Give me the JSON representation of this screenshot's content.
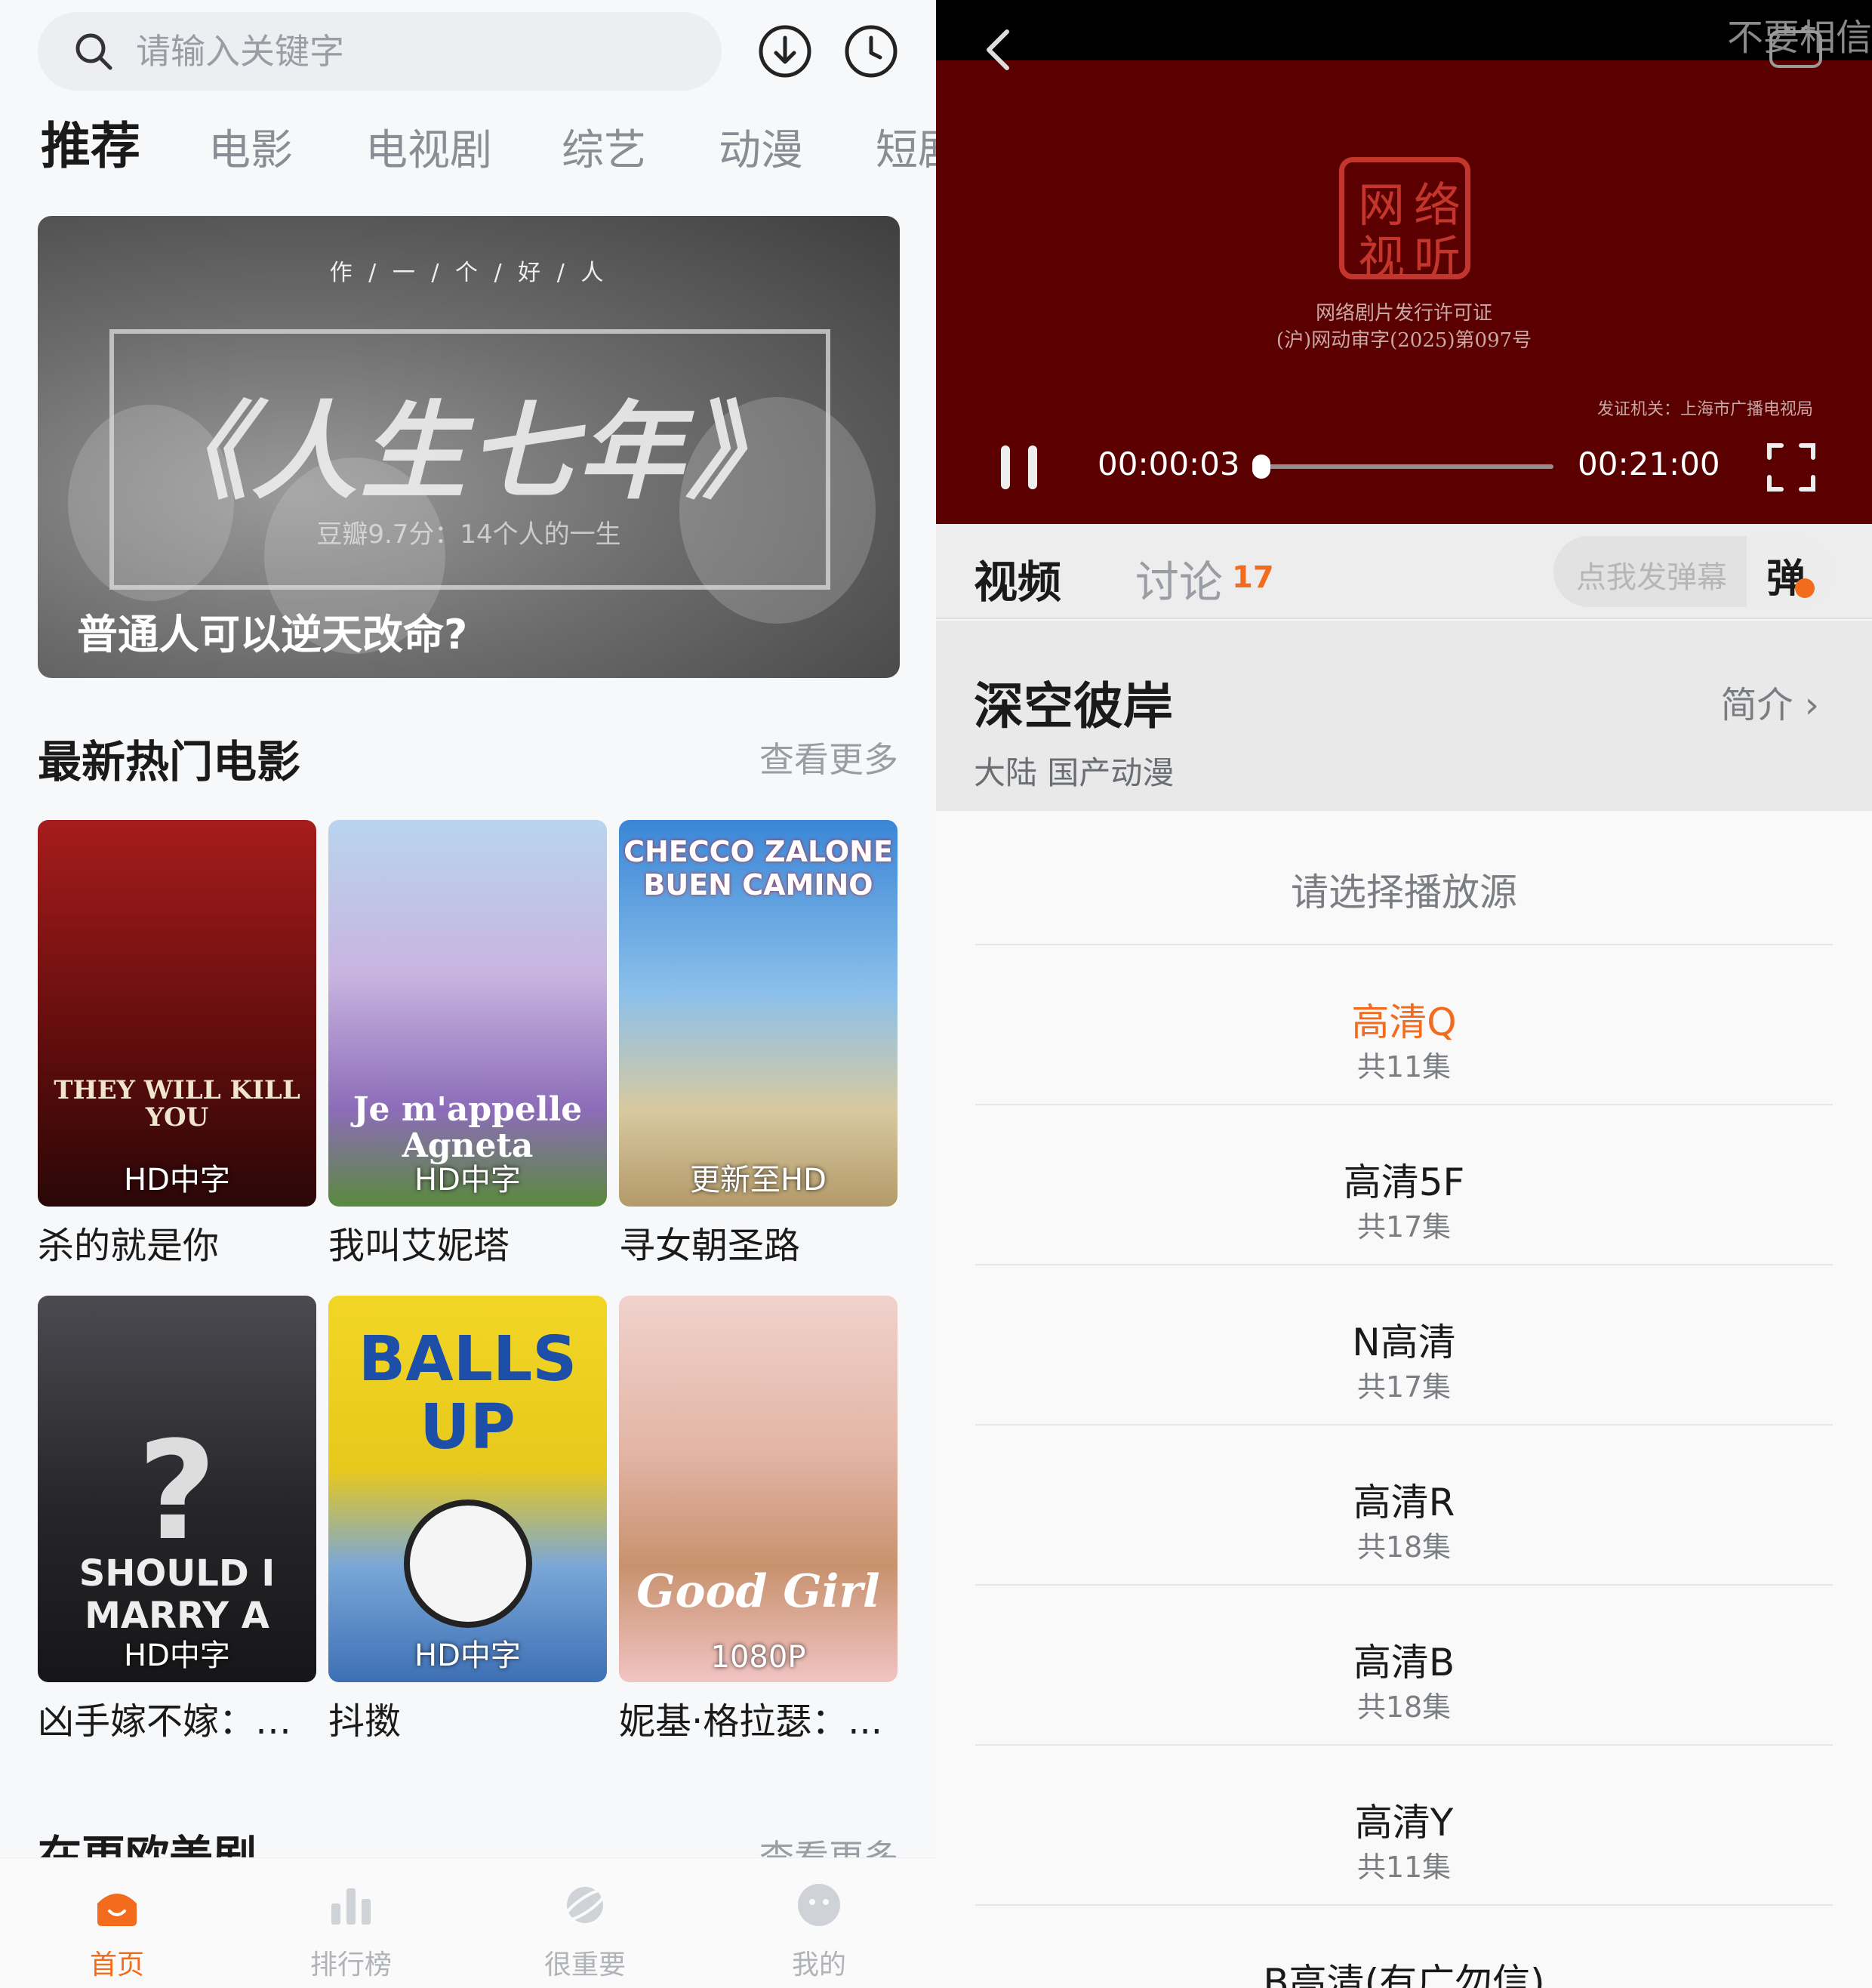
{
  "left": {
    "search": {
      "placeholder": "请输入关键字"
    },
    "tabs": [
      "推荐",
      "电影",
      "电视剧",
      "综艺",
      "动漫",
      "短剧"
    ],
    "banner": {
      "tagline": "作 / 一 / 个 / 好 / 人",
      "title": "《人生七年》",
      "subtitle": "豆瓣9.7分：14个人的一生",
      "caption": "普通人可以逆天改命?"
    },
    "section1": {
      "title": "最新热门电影",
      "more": "查看更多"
    },
    "movies": [
      {
        "name": "杀的就是你",
        "badge": "HD中字",
        "poster_text": "THEY WILL KILL YOU",
        "bg": "#8b1515"
      },
      {
        "name": "我叫艾妮塔",
        "badge": "HD中字",
        "poster_text": "Je m'appelle Agneta",
        "bg": "#a58fc8"
      },
      {
        "name": "寻女朝圣路",
        "badge": "更新至HD",
        "poster_text": "CHECCO ZALONE BUEN CAMINO",
        "bg": "#4f8fd0"
      },
      {
        "name": "凶手嫁不嫁：未...",
        "badge": "HD中字",
        "poster_text": "SHOULD I MARRY A",
        "bg": "#2a2a2e"
      },
      {
        "name": "抖擞",
        "badge": "HD中字",
        "poster_text": "BALLS UP",
        "bg": "#e8d020"
      },
      {
        "name": "妮基·格拉瑟：...",
        "badge": "1080P",
        "poster_text": "Good Girl",
        "bg": "#e0b8b0"
      }
    ],
    "section2": {
      "title": "在更欧美剧",
      "more": "查看更多"
    },
    "nav": [
      {
        "label": "首页",
        "icon": "home-icon"
      },
      {
        "label": "排行榜",
        "icon": "chart-icon"
      },
      {
        "label": "很重要",
        "icon": "planet-icon"
      },
      {
        "label": "我的",
        "icon": "face-icon"
      }
    ]
  },
  "right": {
    "player": {
      "watermark": "不要相信",
      "seal_chars": [
        "网",
        "络",
        "视",
        "听"
      ],
      "license1": "网络剧片发行许可证",
      "license2": "(沪)网动审字(2025)第097号",
      "issuer": "发证机关：上海市广播电视局",
      "current_time": "00:00:03",
      "total_time": "00:21:00",
      "progress": 0.003
    },
    "tabs": {
      "video": "视频",
      "discuss": "讨论",
      "discuss_count": "17"
    },
    "danmu": {
      "placeholder": "点我发弹幕",
      "button": "弹"
    },
    "show": {
      "title": "深空彼岸",
      "intro": "简介 ›",
      "meta": "大陆  国产动漫"
    },
    "sheet": {
      "title": "请选择播放源",
      "sources": [
        {
          "name": "高清Q",
          "count": "共11集",
          "selected": true
        },
        {
          "name": "高清5F",
          "count": "共17集"
        },
        {
          "name": "N高清",
          "count": "共17集"
        },
        {
          "name": "高清R",
          "count": "共18集"
        },
        {
          "name": "高清B",
          "count": "共18集"
        },
        {
          "name": "高清Y",
          "count": "共11集"
        },
        {
          "name": "B高清(有广勿信)",
          "count": ""
        }
      ]
    }
  },
  "colors": {
    "accent": "#f36b1c",
    "player_bg": "#5a0000"
  }
}
